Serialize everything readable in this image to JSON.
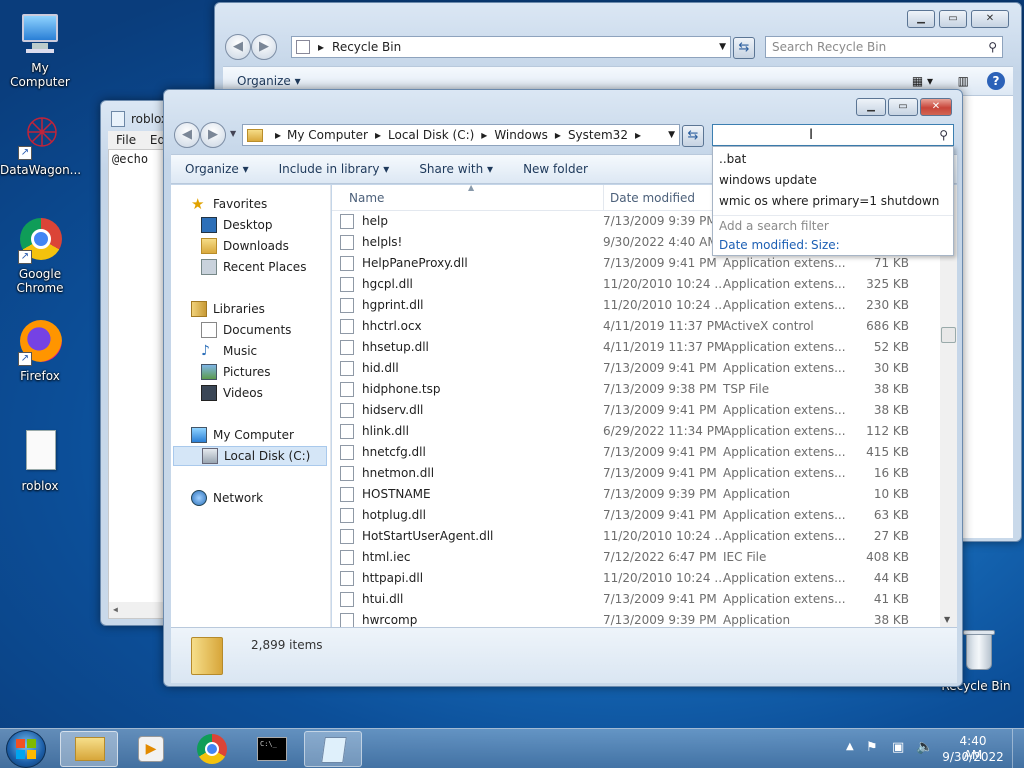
{
  "desktop": {
    "icons": [
      {
        "label": "My Computer"
      },
      {
        "label": "DataWagon..."
      },
      {
        "label": "Google Chrome"
      },
      {
        "label": "Firefox"
      },
      {
        "label": "roblox"
      },
      {
        "label": "Recycle Bin"
      }
    ]
  },
  "recycle_window": {
    "address": "Recycle Bin",
    "search_placeholder": "Search Recycle Bin",
    "organize": "Organize"
  },
  "notepad": {
    "title": "roblox",
    "menu_file": "File",
    "menu_edit": "Edi",
    "content": "@echo"
  },
  "explorer": {
    "breadcrumb": [
      "My Computer",
      "Local Disk (C:)",
      "Windows",
      "System32"
    ],
    "search_value": "",
    "toolbar": {
      "organize": "Organize",
      "include": "Include in library",
      "share": "Share with",
      "new_folder": "New folder"
    },
    "nav": {
      "favorites": "Favorites",
      "desktop": "Desktop",
      "downloads": "Downloads",
      "recent": "Recent Places",
      "libraries": "Libraries",
      "documents": "Documents",
      "music": "Music",
      "pictures": "Pictures",
      "videos": "Videos",
      "computer": "My Computer",
      "local_disk": "Local Disk (C:)",
      "network": "Network"
    },
    "columns": {
      "name": "Name",
      "date": "Date modified"
    },
    "files": [
      {
        "name": "help",
        "date": "7/13/2009 9:39 PM",
        "type": "",
        "size": ""
      },
      {
        "name": "helpls!",
        "date": "9/30/2022 4:40 AM",
        "type": "",
        "size": ""
      },
      {
        "name": "HelpPaneProxy.dll",
        "date": "7/13/2009 9:41 PM",
        "type": "Application extens...",
        "size": "71 KB"
      },
      {
        "name": "hgcpl.dll",
        "date": "11/20/2010 10:24 ...",
        "type": "Application extens...",
        "size": "325 KB"
      },
      {
        "name": "hgprint.dll",
        "date": "11/20/2010 10:24 ...",
        "type": "Application extens...",
        "size": "230 KB"
      },
      {
        "name": "hhctrl.ocx",
        "date": "4/11/2019 11:37 PM",
        "type": "ActiveX control",
        "size": "686 KB"
      },
      {
        "name": "hhsetup.dll",
        "date": "4/11/2019 11:37 PM",
        "type": "Application extens...",
        "size": "52 KB"
      },
      {
        "name": "hid.dll",
        "date": "7/13/2009 9:41 PM",
        "type": "Application extens...",
        "size": "30 KB"
      },
      {
        "name": "hidphone.tsp",
        "date": "7/13/2009 9:38 PM",
        "type": "TSP File",
        "size": "38 KB"
      },
      {
        "name": "hidserv.dll",
        "date": "7/13/2009 9:41 PM",
        "type": "Application extens...",
        "size": "38 KB"
      },
      {
        "name": "hlink.dll",
        "date": "6/29/2022 11:34 PM",
        "type": "Application extens...",
        "size": "112 KB"
      },
      {
        "name": "hnetcfg.dll",
        "date": "7/13/2009 9:41 PM",
        "type": "Application extens...",
        "size": "415 KB"
      },
      {
        "name": "hnetmon.dll",
        "date": "7/13/2009 9:41 PM",
        "type": "Application extens...",
        "size": "16 KB"
      },
      {
        "name": "HOSTNAME",
        "date": "7/13/2009 9:39 PM",
        "type": "Application",
        "size": "10 KB"
      },
      {
        "name": "hotplug.dll",
        "date": "7/13/2009 9:41 PM",
        "type": "Application extens...",
        "size": "63 KB"
      },
      {
        "name": "HotStartUserAgent.dll",
        "date": "11/20/2010 10:24 ...",
        "type": "Application extens...",
        "size": "27 KB"
      },
      {
        "name": "html.iec",
        "date": "7/12/2022 6:47 PM",
        "type": "IEC File",
        "size": "408 KB"
      },
      {
        "name": "httpapi.dll",
        "date": "11/20/2010 10:24 ...",
        "type": "Application extens...",
        "size": "44 KB"
      },
      {
        "name": "htui.dll",
        "date": "7/13/2009 9:41 PM",
        "type": "Application extens...",
        "size": "41 KB"
      },
      {
        "name": "hwrcomp",
        "date": "7/13/2009 9:39 PM",
        "type": "Application",
        "size": "38 KB"
      }
    ],
    "suggestions": [
      "..bat",
      "windows update",
      "wmic os where primary=1 shutdown"
    ],
    "filter_hint": "Add a search filter",
    "filter_date": "Date modified:",
    "filter_size": "Size:",
    "status": "2,899 items"
  },
  "clock": {
    "time": "4:40 AM",
    "date": "9/30/2022"
  }
}
